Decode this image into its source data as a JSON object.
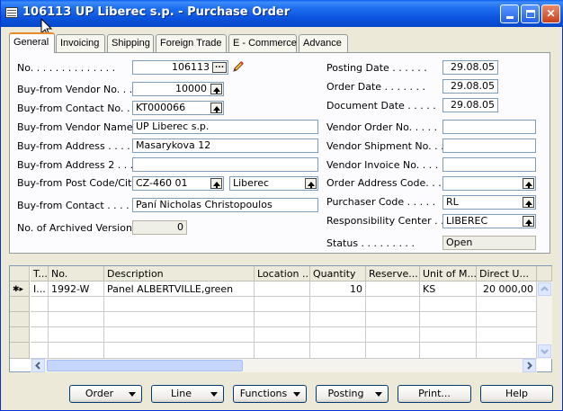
{
  "window": {
    "title": "106113 UP Liberec s.p. - Purchase Order"
  },
  "tabs": [
    {
      "label": "General"
    },
    {
      "label": "Invoicing"
    },
    {
      "label": "Shipping"
    },
    {
      "label": "Foreign Trade"
    },
    {
      "label": "E - Commerce"
    },
    {
      "label": "Advance"
    }
  ],
  "left_fields": {
    "no": {
      "label": "No. . . . . . . . . . . . . .",
      "value": "106113"
    },
    "vendor_no": {
      "label": "Buy-from Vendor No. . . .",
      "value": "10000"
    },
    "contact_no": {
      "label": "Buy-from Contact No. . .",
      "value": "KT000066"
    },
    "vendor_name": {
      "label": "Buy-from Vendor Name . .",
      "value": "UP Liberec s.p."
    },
    "address": {
      "label": "Buy-from Address . . . .",
      "value": "Masarykova 12"
    },
    "address2": {
      "label": "Buy-from Address 2 . . .",
      "value": ""
    },
    "post_code_city": {
      "label": "Buy-from Post Code/City",
      "post_code": "CZ-460 01",
      "city": "Liberec"
    },
    "contact": {
      "label": "Buy-from Contact . . . .",
      "value": "Paní Nicholas Christopoulos"
    },
    "archived": {
      "label": "No. of Archived Versions.",
      "value": "0"
    }
  },
  "right_fields": {
    "posting_date": {
      "label": "Posting Date . . . . . .",
      "value": "29.08.05"
    },
    "order_date": {
      "label": "Order Date . . . . . . .",
      "value": "29.08.05"
    },
    "document_date": {
      "label": "Document Date . . . . .",
      "value": "29.08.05"
    },
    "vendor_order_no": {
      "label": "Vendor Order No. . . . .",
      "value": ""
    },
    "vendor_shipment_no": {
      "label": "Vendor Shipment No. . . .",
      "value": ""
    },
    "vendor_invoice_no": {
      "label": "Vendor Invoice No. . . .",
      "value": ""
    },
    "order_address_code": {
      "label": "Order Address Code. . . .",
      "value": ""
    },
    "purchaser_code": {
      "label": "Purchaser Code . . . . .",
      "value": "RL"
    },
    "responsibility_center": {
      "label": "Responsibility Center . .",
      "value": "LIBEREC"
    },
    "status": {
      "label": "Status . . . . . . . . .",
      "value": "Open"
    }
  },
  "lines": {
    "columns": [
      "T...",
      "No.",
      "Description",
      "Location ...",
      "Quantity",
      "Reserve...",
      "Unit of M...",
      "Direct U..."
    ],
    "rows": [
      {
        "marker": "✱▸",
        "type": "I...",
        "no": "1992-W",
        "description": "Panel ALBERTVILLE,green",
        "location": "",
        "quantity": "10",
        "reserved": "",
        "uom": "KS",
        "direct_unit_cost": "20 000,00"
      }
    ]
  },
  "buttons": {
    "order": "Order",
    "line": "Line",
    "functions": "Functions",
    "posting": "Posting",
    "print": "Print...",
    "help": "Help"
  },
  "colors": {
    "title_bar": "#0a52dd",
    "window_bg": "#ece9d8",
    "active_tab_accent": "#e68b2c"
  }
}
